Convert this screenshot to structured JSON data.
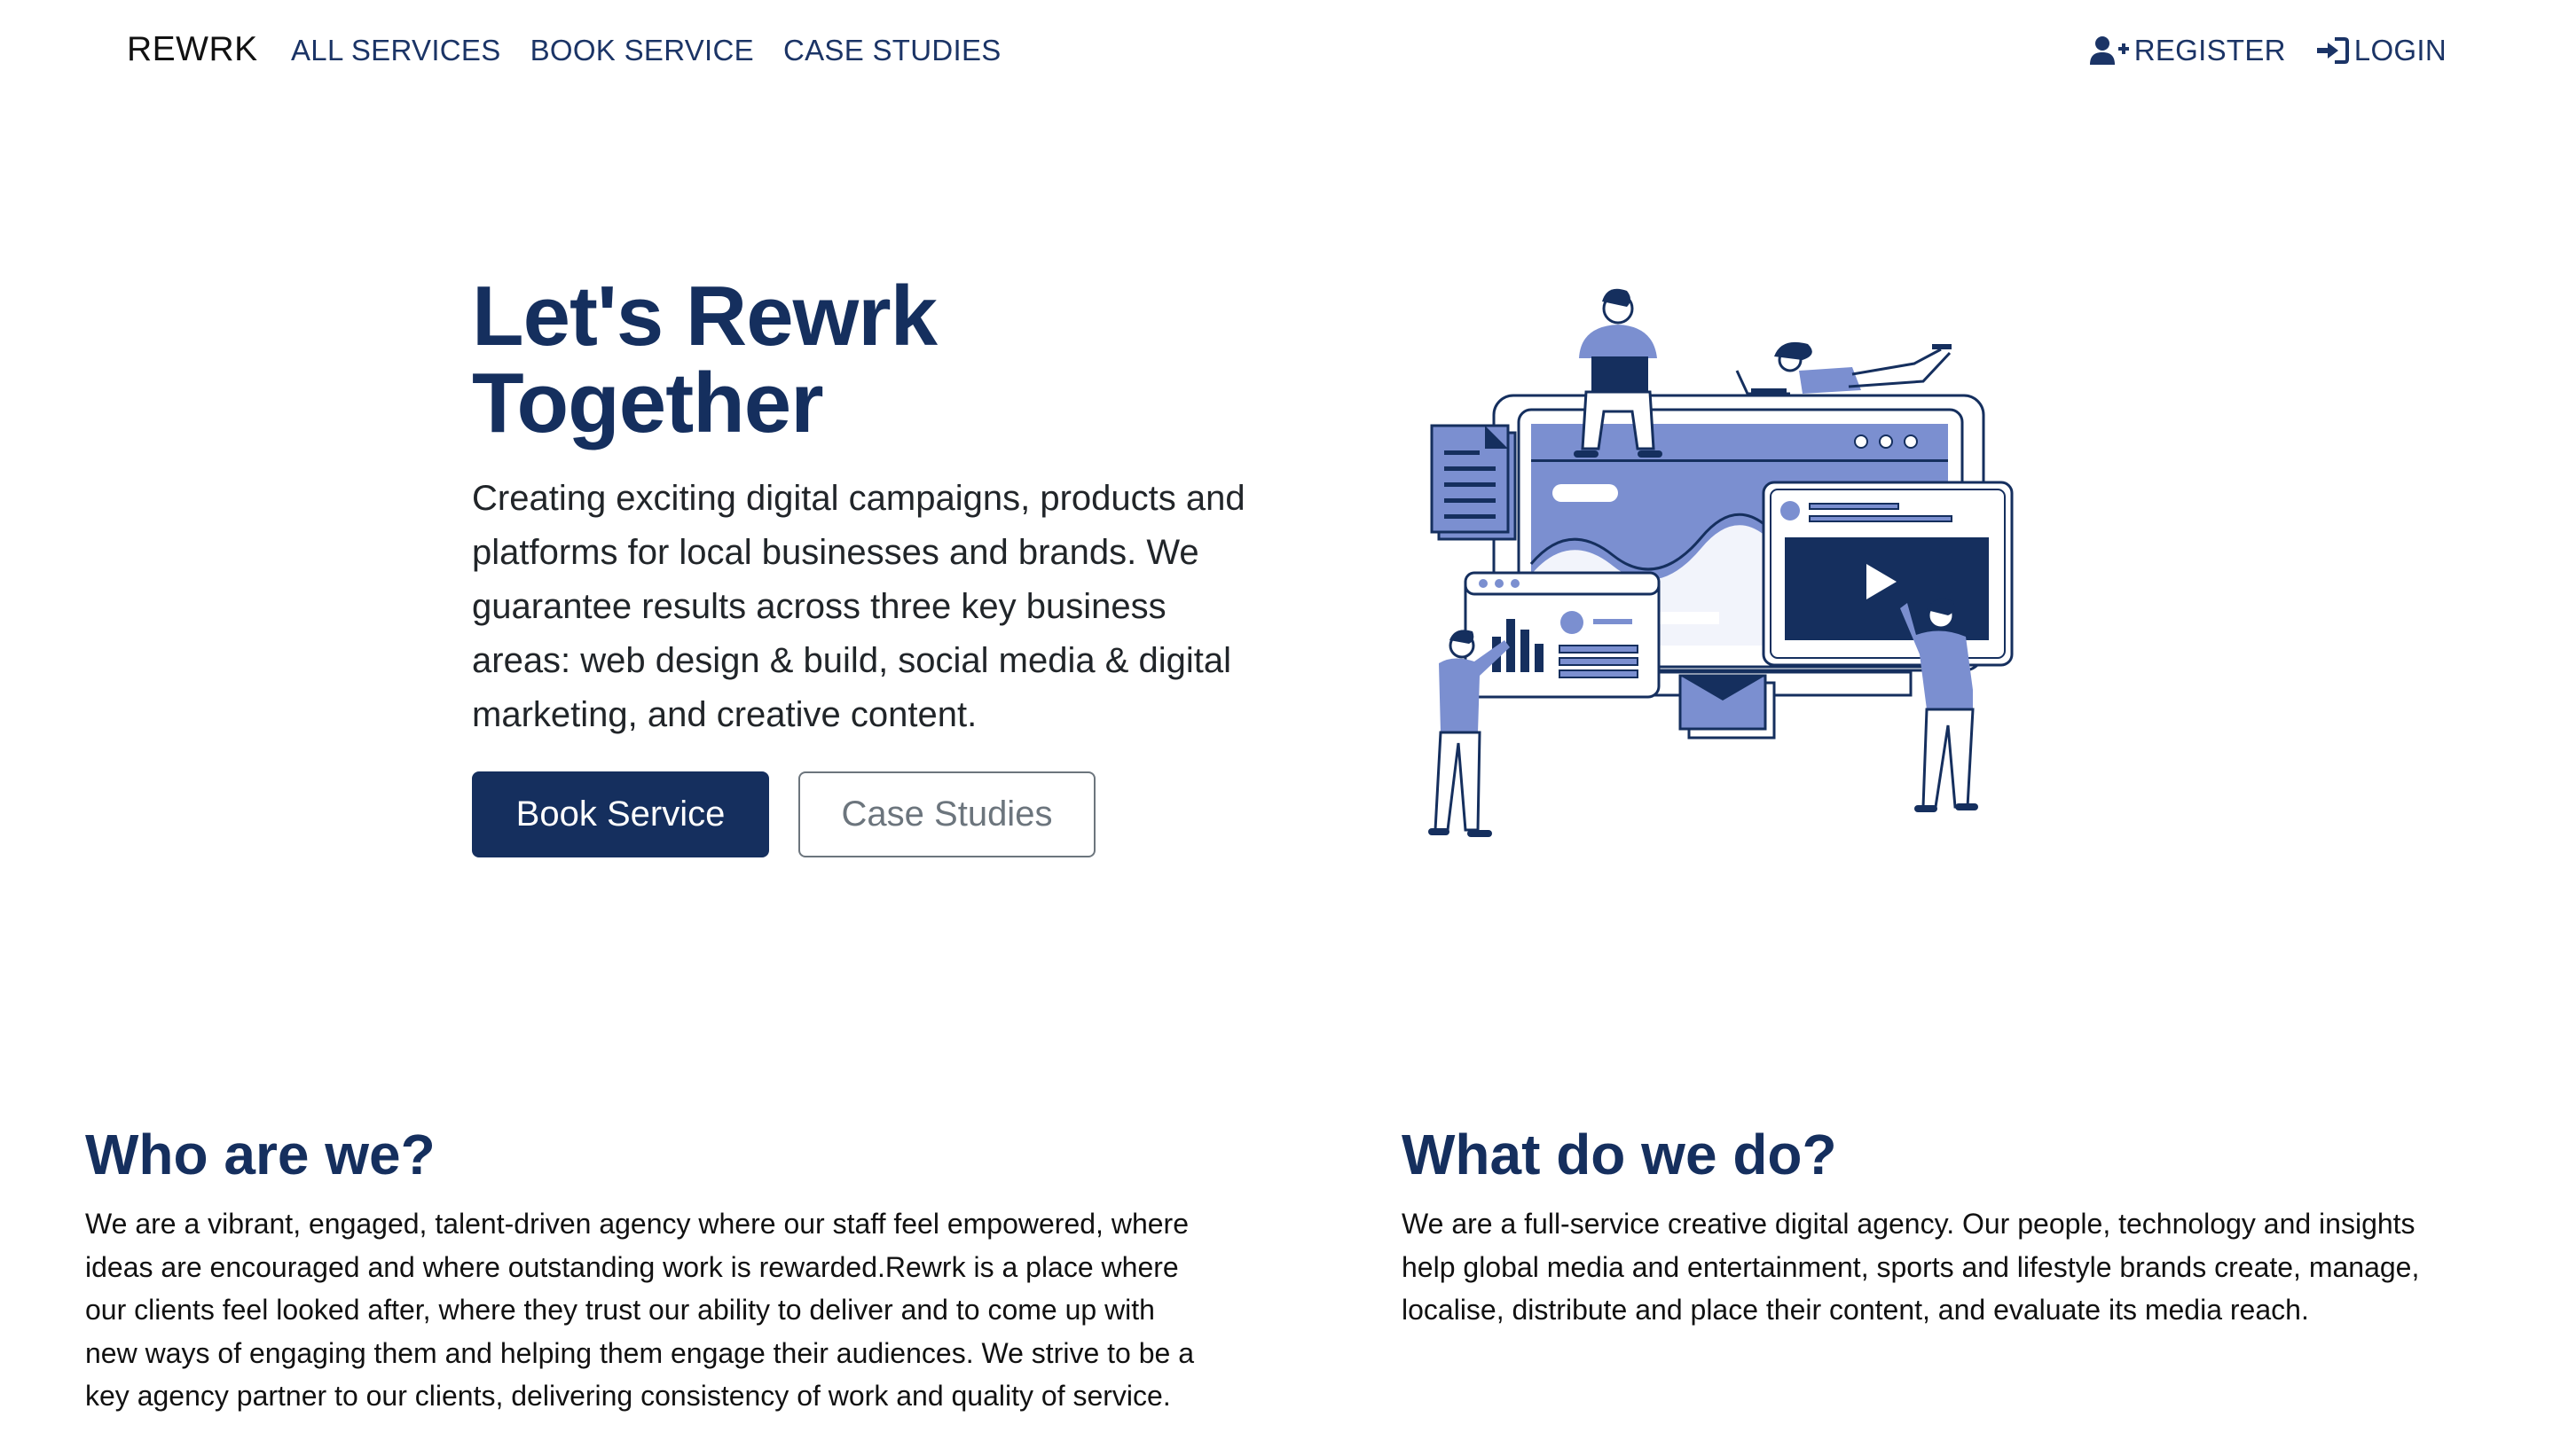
{
  "nav": {
    "brand": "REWRK",
    "links": [
      {
        "label": "ALL SERVICES"
      },
      {
        "label": "BOOK SERVICE"
      },
      {
        "label": "CASE STUDIES"
      }
    ],
    "register_label": "REGISTER",
    "login_label": "LOGIN",
    "register_icon": "user-plus-icon",
    "login_icon": "sign-in-icon"
  },
  "hero": {
    "title": "Let's Rewrk Together",
    "lead": "Creating exciting digital campaigns, products and platforms for local businesses and brands. We guarantee results across three key business areas: web design & build, social media & digital marketing, and creative content.",
    "primary_button": "Book Service",
    "secondary_button": "Case Studies",
    "illustration": "team-building-website-illustration"
  },
  "who": {
    "title": "Who are we?",
    "body": "We are a vibrant, engaged, talent-driven agency where our staff feel empowered, where ideas are encouraged and where outstanding work is rewarded.Rewrk is a place where our clients feel looked after, where they trust our ability to deliver and to come up with new ways of engaging them and helping them engage their audiences. We strive to be a key agency partner to our clients, delivering consistency of work and quality of service."
  },
  "what": {
    "title": "What do we do?",
    "body": "We are a full-service creative digital agency. Our people, technology and insights help global media and entertainment, sports and lifestyle brands create, manage, localise, distribute and place their content, and evaluate its media reach."
  },
  "colors": {
    "brand_navy": "#152f5e",
    "illustration_lavender": "#7b8fd0",
    "secondary_grey": "#6c757d"
  }
}
